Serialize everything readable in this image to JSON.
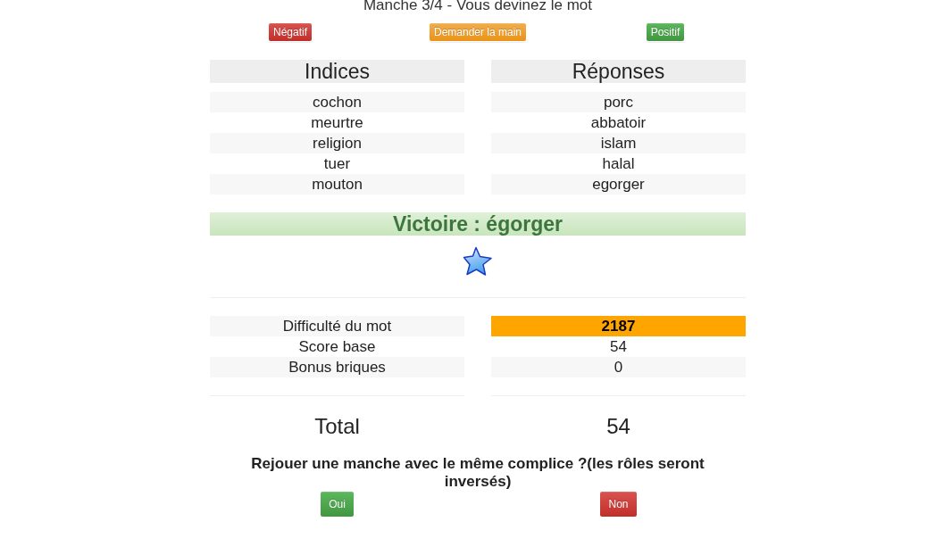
{
  "title": "Manche 3/4 - Vous devinez le mot",
  "actions": [
    {
      "label": "Négatif",
      "kind": "danger"
    },
    {
      "label": "Demander la main",
      "kind": "warning"
    },
    {
      "label": "Positif",
      "kind": "success"
    }
  ],
  "words": {
    "columns": [
      "Indices",
      "Réponses"
    ],
    "rows": [
      [
        "cochon",
        "porc"
      ],
      [
        "meurtre",
        "abbatoir"
      ],
      [
        "religion",
        "islam"
      ],
      [
        "tuer",
        "halal"
      ],
      [
        "mouton",
        "egorger"
      ]
    ]
  },
  "result": {
    "label": "Victoire : égorger",
    "kind": "victory"
  },
  "stats": [
    {
      "label": "Difficulté du mot",
      "value": "2187",
      "color": "#ffa500"
    },
    {
      "label": "Score base",
      "value": "54"
    },
    {
      "label": "Bonus briques",
      "value": "0"
    }
  ],
  "total": {
    "label": "Total",
    "value": "54"
  },
  "replay": {
    "question": "Rejouer une manche avec le même complice ?(les rôles seront inversés)",
    "buttons": [
      {
        "label": "Oui",
        "kind": "success"
      },
      {
        "label": "Non",
        "kind": "danger"
      }
    ]
  }
}
